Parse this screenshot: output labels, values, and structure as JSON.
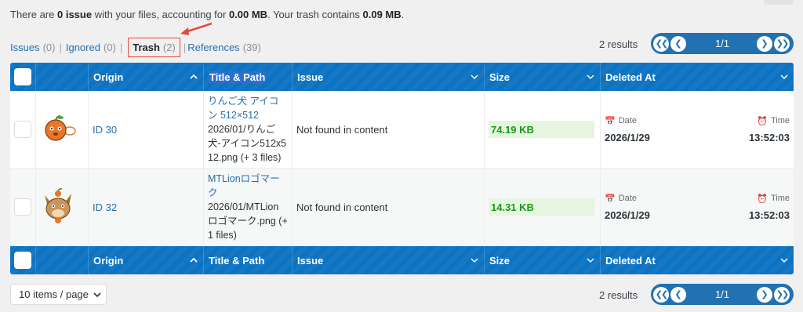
{
  "summary": {
    "prefix": "There are ",
    "issue_count": "0 issue",
    "mid": " with your files, accounting for ",
    "size": "0.00 MB",
    "mid2": ". Your trash contains ",
    "trash_size": "0.09 MB",
    "suffix": "."
  },
  "filters": {
    "issues": {
      "label": "Issues",
      "count": "(0)"
    },
    "ignored": {
      "label": "Ignored",
      "count": "(0)"
    },
    "trash": {
      "label": "Trash",
      "count": "(2)"
    },
    "references": {
      "label": "References",
      "count": "(39)"
    },
    "separator": "|"
  },
  "pagination": {
    "results": "2 results",
    "page": "1/1"
  },
  "columns": {
    "origin": "Origin",
    "title_path": "Title & Path",
    "issue": "Issue",
    "size": "Size",
    "deleted_at": "Deleted At"
  },
  "rows": [
    {
      "origin": "ID 30",
      "title": "りんご犬 アイコン 512×512",
      "path": "2026/01/りんご犬-アイコン512x512.png (+ 3 files)",
      "issue": "Not found in content",
      "size": "74.19 KB",
      "date_label": "Date",
      "time_label": "Time",
      "date": "2026/1/29",
      "time": "13:52:03"
    },
    {
      "origin": "ID 32",
      "title": "MTLionロゴマーク",
      "path": "2026/01/MTLionロゴマーク.png (+ 1 files)",
      "issue": "Not found in content",
      "size": "14.31 KB",
      "date_label": "Date",
      "time_label": "Time",
      "date": "2026/1/29",
      "time": "13:52:03"
    }
  ],
  "items_per_page": "10 items / page",
  "colors": {
    "header": "#0c73c2",
    "link": "#2271b1",
    "size_text": "#1a9a1a",
    "size_bg": "#e5f5e0",
    "highlight": "#e8483a"
  }
}
